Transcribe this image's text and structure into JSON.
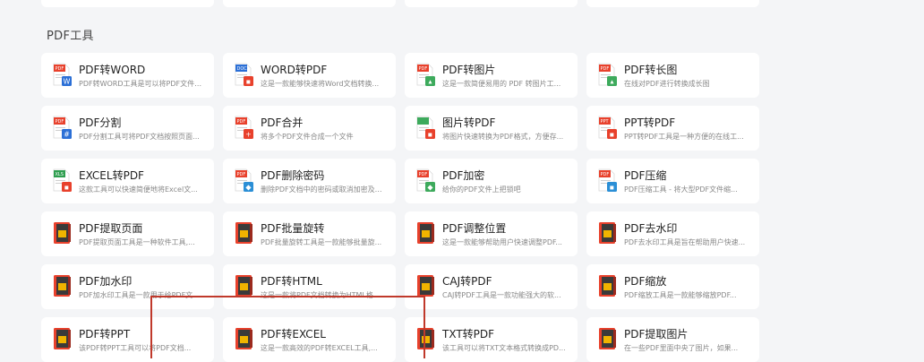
{
  "section_title": "PDF工具",
  "tools": [
    {
      "name": "PDF转WORD",
      "desc": "PDF转WORD工具是可以将PDF文件格...",
      "icon": "pdf-to-word-icon",
      "iconType": "conv",
      "color": "#e8412c",
      "accent": "#2b6fd6",
      "tag": "PDF",
      "mark": "W"
    },
    {
      "name": "WORD转PDF",
      "desc": "这是一款能够快速将Word文档转换...",
      "icon": "word-to-pdf-icon",
      "iconType": "conv",
      "color": "#2b6fd6",
      "accent": "#e8412c",
      "tag": "DOC",
      "mark": "▪"
    },
    {
      "name": "PDF转图片",
      "desc": "这是一款简便易用的 PDF 转图片工...",
      "icon": "pdf-to-image-icon",
      "iconType": "conv",
      "color": "#e8412c",
      "accent": "#3daa5c",
      "tag": "PDF",
      "mark": "▴"
    },
    {
      "name": "PDF转长图",
      "desc": "在线对PDF进行转换成长图",
      "icon": "pdf-to-long-image-icon",
      "iconType": "conv",
      "color": "#e8412c",
      "accent": "#3daa5c",
      "tag": "PDF",
      "mark": "▴"
    },
    {
      "name": "PDF分割",
      "desc": "PDF分割工具可将PDF文档按照页面...",
      "icon": "pdf-split-icon",
      "iconType": "conv",
      "color": "#e8412c",
      "accent": "#2b6fd6",
      "tag": "PDF",
      "mark": "#"
    },
    {
      "name": "PDF合并",
      "desc": "将多个PDF文件合成一个文件",
      "icon": "pdf-merge-icon",
      "iconType": "conv",
      "color": "#e8412c",
      "accent": "#e8412c",
      "tag": "PDF",
      "mark": "+"
    },
    {
      "name": "图片转PDF",
      "desc": "将图片快速转换为PDF格式，方便存...",
      "icon": "image-to-pdf-icon",
      "iconType": "conv",
      "color": "#3daa5c",
      "accent": "#e8412c",
      "tag": "",
      "mark": "▪"
    },
    {
      "name": "PPT转PDF",
      "desc": "PPT转PDF工具是一种方便的在线工...",
      "icon": "ppt-to-pdf-icon",
      "iconType": "conv",
      "color": "#e8412c",
      "accent": "#e8412c",
      "tag": "PPT",
      "mark": "▪"
    },
    {
      "name": "EXCEL转PDF",
      "desc": "这款工具可以快速简便地将Excel文...",
      "icon": "excel-to-pdf-icon",
      "iconType": "conv",
      "color": "#2e9e4f",
      "accent": "#e8412c",
      "tag": "XLS",
      "mark": "▪"
    },
    {
      "name": "PDF删除密码",
      "desc": "删除PDF文档中的密码或取消加密及权...",
      "icon": "pdf-remove-password-icon",
      "iconType": "conv",
      "color": "#e8412c",
      "accent": "#2b8fd6",
      "tag": "PDF",
      "mark": "◆"
    },
    {
      "name": "PDF加密",
      "desc": "给你的PDF文件上把锁吧",
      "icon": "pdf-encrypt-icon",
      "iconType": "conv",
      "color": "#e8412c",
      "accent": "#3daa5c",
      "tag": "PDF",
      "mark": "◆"
    },
    {
      "name": "PDF压缩",
      "desc": "PDF压缩工具 - 将大型PDF文件缩...",
      "icon": "pdf-compress-icon",
      "iconType": "conv",
      "color": "#e8412c",
      "accent": "#2b8fd6",
      "tag": "PDF",
      "mark": "▪"
    },
    {
      "name": "PDF提取页面",
      "desc": "PDF提取页面工具是一种软件工具,...",
      "icon": "pdf-extract-pages-icon",
      "iconType": "book",
      "color": "#e8412c",
      "accent": "#f0b400",
      "tag": "",
      "mark": ""
    },
    {
      "name": "PDF批量旋转",
      "desc": "PDF批量旋转工具是一款能够批量旋...",
      "icon": "pdf-batch-rotate-icon",
      "iconType": "book",
      "color": "#e8412c",
      "accent": "#f0b400",
      "tag": "",
      "mark": ""
    },
    {
      "name": "PDF调整位置",
      "desc": "这是一款能够帮助用户快速调整PDF...",
      "icon": "pdf-adjust-position-icon",
      "iconType": "book",
      "color": "#e8412c",
      "accent": "#f0b400",
      "tag": "",
      "mark": ""
    },
    {
      "name": "PDF去水印",
      "desc": "PDF去水印工具是旨在帮助用户快速...",
      "icon": "pdf-remove-watermark-icon",
      "iconType": "book",
      "color": "#e8412c",
      "accent": "#f0b400",
      "tag": "",
      "mark": ""
    },
    {
      "name": "PDF加水印",
      "desc": "PDF加水印工具是一款用于给PDF文...",
      "icon": "pdf-add-watermark-icon",
      "iconType": "book",
      "color": "#e8412c",
      "accent": "#f0b400",
      "tag": "",
      "mark": ""
    },
    {
      "name": "PDF转HTML",
      "desc": "这是一款将PDF文档转换为HTML格...",
      "icon": "pdf-to-html-icon",
      "iconType": "book",
      "color": "#e8412c",
      "accent": "#f0b400",
      "tag": "",
      "mark": ""
    },
    {
      "name": "CAJ转PDF",
      "desc": "CAJ转PDF工具是一款功能强大的软...",
      "icon": "caj-to-pdf-icon",
      "iconType": "book",
      "color": "#e8412c",
      "accent": "#f0b400",
      "tag": "",
      "mark": ""
    },
    {
      "name": "PDF缩放",
      "desc": "PDF缩放工具是一款能够缩放PDF...",
      "icon": "pdf-zoom-icon",
      "iconType": "book",
      "color": "#e8412c",
      "accent": "#f0b400",
      "tag": "",
      "mark": ""
    },
    {
      "name": "PDF转PPT",
      "desc": "该PDF转PPT工具可以将PDF文档...",
      "icon": "pdf-to-ppt-icon",
      "iconType": "book",
      "color": "#e8412c",
      "accent": "#f0b400",
      "tag": "",
      "mark": ""
    },
    {
      "name": "PDF转EXCEL",
      "desc": "这是一款高效的PDF转EXCEL工具,...",
      "icon": "pdf-to-excel-icon",
      "iconType": "book",
      "color": "#e8412c",
      "accent": "#f0b400",
      "tag": "",
      "mark": ""
    },
    {
      "name": "TXT转PDF",
      "desc": "该工具可以将TXT文本格式转换成PD...",
      "icon": "txt-to-pdf-icon",
      "iconType": "book",
      "color": "#e8412c",
      "accent": "#f0b400",
      "tag": "",
      "mark": ""
    },
    {
      "name": "PDF提取图片",
      "desc": "在一些PDF里面中央了图片，如果...",
      "icon": "pdf-extract-images-icon",
      "iconType": "book",
      "color": "#e8412c",
      "accent": "#f0b400",
      "tag": "",
      "mark": ""
    }
  ],
  "annotation_color": "#c0392b"
}
